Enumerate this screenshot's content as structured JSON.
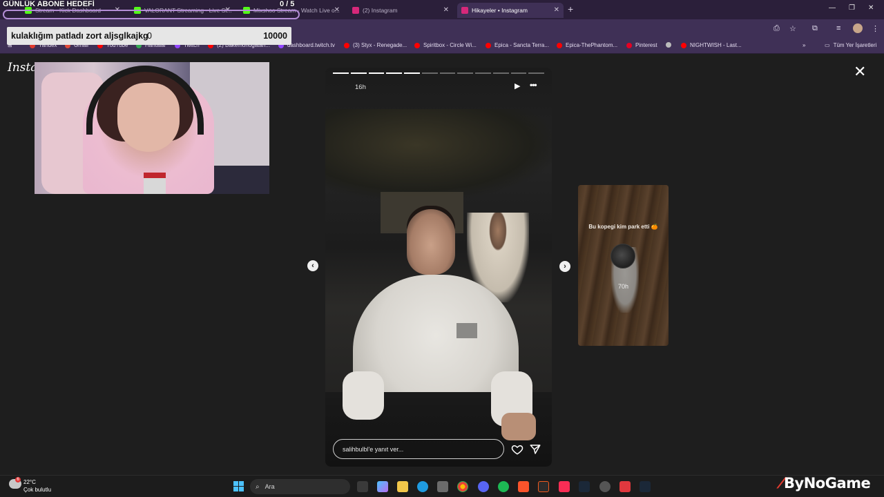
{
  "overlay": {
    "goal_title": "GÜNLÜK ABONE HEDEFİ",
    "goal_count": "0  / 5",
    "goal_text": "kulaklığım patladı zort aljsglkajkg",
    "goal_value": "0",
    "goal_max": "10000"
  },
  "browser": {
    "tabs": [
      {
        "label": "Stream - Kick Dashboard"
      },
      {
        "label": "VALORANT Streaming - Live St..."
      },
      {
        "label": "Mixshoo Stream - Watch Live o..."
      },
      {
        "label": "(2) Instagram"
      },
      {
        "label": "Hikayeler • Instagram"
      }
    ],
    "bookmarks": [
      {
        "label": "Yandex",
        "color": "#e03a2e"
      },
      {
        "label": "Gmail",
        "color": "#e04b3a"
      },
      {
        "label": "YouTube",
        "color": "#ff0000"
      },
      {
        "label": "Haritalar",
        "color": "#34a853"
      },
      {
        "label": "Twitch",
        "color": "#9146ff"
      },
      {
        "label": "(2) Bakemonogatari...",
        "color": "#ff0000"
      },
      {
        "label": "dashboard.twitch.tv",
        "color": "#9146ff"
      },
      {
        "label": "(3) Styx - Renegade...",
        "color": "#ff0000"
      },
      {
        "label": "Spiritbox - Circle Wi...",
        "color": "#ff0000"
      },
      {
        "label": "Epica - Sancta Terra...",
        "color": "#ff0000"
      },
      {
        "label": "Epica-ThePhantom...",
        "color": "#ff0000"
      },
      {
        "label": "Pinterest",
        "color": "#e60023"
      },
      {
        "label": "",
        "color": "#bbbbbb"
      },
      {
        "label": "NIGHTWISH - Last...",
        "color": "#ff0000"
      }
    ],
    "all_bookmarks": "Tüm Yer İşaretleri"
  },
  "instagram": {
    "logo": "Instag"
  },
  "story": {
    "time": "16h",
    "progress_done": 5,
    "progress_total": 12,
    "reply_placeholder": "salihbulbl'e yanıt ver..."
  },
  "next_story": {
    "caption": "Bu kopegi kim park etti 🍊",
    "time": "70h"
  },
  "taskbar": {
    "temperature": "22°C",
    "condition": "Çok bulutlu",
    "weather_badge": "6",
    "search_label": "Ara",
    "watermark": "ByNoGame"
  },
  "colors": {
    "browser_frame": "#3f3056",
    "tabstrip": "#2b1f3a",
    "goal_outline": "#b48ed6",
    "accent_red": "#e03a2e"
  }
}
